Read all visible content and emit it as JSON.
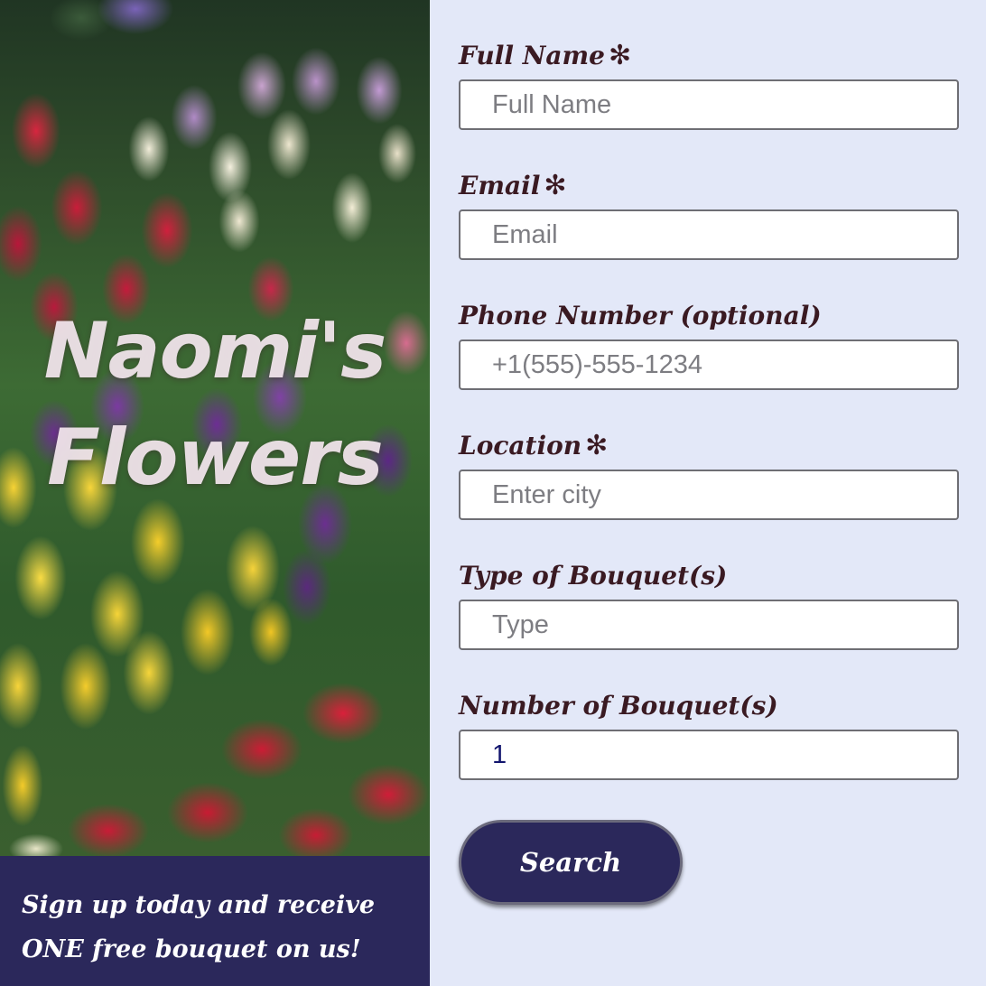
{
  "hero": {
    "title_line1": "Naomi's",
    "title_line2": "Flowers",
    "image": "tulip-field-photo",
    "promo_line1": "Sign up today and receive",
    "promo_line2": "ONE free bouquet on us!"
  },
  "form": {
    "required_marker": "✻",
    "fields": {
      "full_name": {
        "label": "Full Name",
        "required": true,
        "placeholder": "Full Name",
        "value": ""
      },
      "email": {
        "label": "Email",
        "required": true,
        "placeholder": "Email",
        "value": ""
      },
      "phone": {
        "label": "Phone Number (optional)",
        "required": false,
        "placeholder": "+1(555)-555-1234",
        "value": ""
      },
      "location": {
        "label": "Location",
        "required": true,
        "placeholder": "Enter city",
        "value": ""
      },
      "bouquet_type": {
        "label": "Type of Bouquet(s)",
        "required": false,
        "placeholder": "Type",
        "value": ""
      },
      "bouquet_count": {
        "label": "Number of Bouquet(s)",
        "required": false,
        "placeholder": "",
        "value": "1"
      }
    },
    "submit_label": "Search"
  },
  "colors": {
    "page_background": "#e3e8f8",
    "label_text": "#3a1a22",
    "accent_navy": "#2b285b",
    "input_value_text": "#12156e"
  }
}
